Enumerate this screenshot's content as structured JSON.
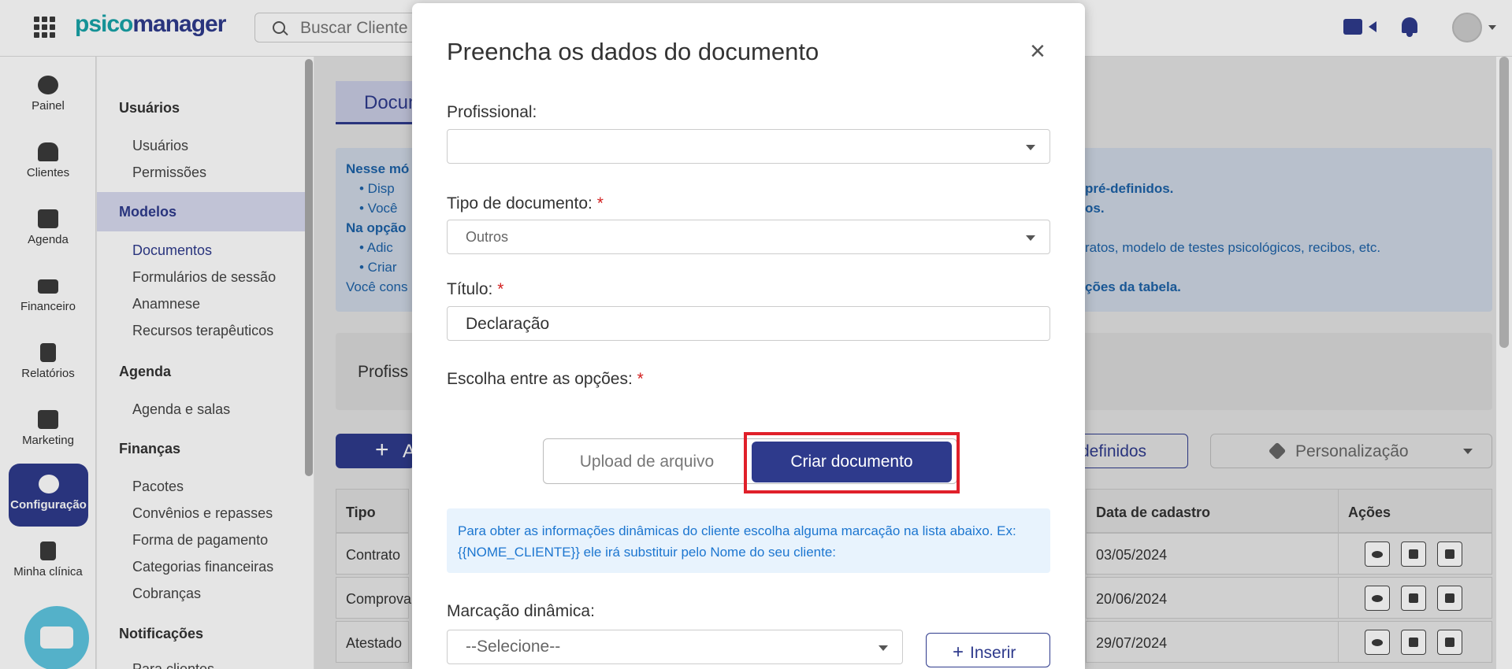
{
  "topbar": {
    "logo_a": "psico",
    "logo_b": "manager",
    "search_placeholder": "Buscar Cliente",
    "icons": [
      "apps-grid-icon",
      "search-icon",
      "video-icon",
      "bell-icon",
      "avatar"
    ]
  },
  "rail": {
    "items": [
      {
        "label": "Painel",
        "icon": "dashboard-icon"
      },
      {
        "label": "Clientes",
        "icon": "users-icon"
      },
      {
        "label": "Agenda",
        "icon": "calendar-icon"
      },
      {
        "label": "Financeiro",
        "icon": "money-icon"
      },
      {
        "label": "Relatórios",
        "icon": "report-icon"
      },
      {
        "label": "Marketing",
        "icon": "megaphone-icon"
      },
      {
        "label": "Configuração",
        "icon": "gear-icon"
      },
      {
        "label": "Minha clínica",
        "icon": "building-icon"
      }
    ]
  },
  "submenu": {
    "sections": [
      {
        "title": "Usuários",
        "items": [
          "Usuários",
          "Permissões"
        ]
      },
      {
        "title": "Modelos",
        "items": [
          "Documentos",
          "Formulários de sessão",
          "Anamnese",
          "Recursos terapêuticos"
        ]
      },
      {
        "title": "Agenda",
        "items": [
          "Agenda e salas"
        ]
      },
      {
        "title": "Finanças",
        "items": [
          "Pacotes",
          "Convênios e repasses",
          "Forma de pagamento",
          "Categorias financeiras",
          "Cobranças"
        ]
      },
      {
        "title": "Notificações",
        "items": [
          "Para clientes"
        ]
      }
    ]
  },
  "background": {
    "tab": "Docum",
    "info_lines": [
      {
        "left": "Nesse mó",
        "right": ""
      },
      {
        "left": "• Disp",
        "right": "pré-definidos."
      },
      {
        "left": "• Você",
        "right": "os."
      },
      {
        "left": "Na opção",
        "right": ""
      },
      {
        "left": "• Adic",
        "right": "ratos, modelo de testes psicológicos, recibos, etc."
      },
      {
        "left": "• Criar",
        "right": ""
      },
      {
        "left": "Você cons",
        "right": "ções da tabela."
      }
    ],
    "prof_label": "Profiss",
    "add_label": "A",
    "predef_label": "definidos",
    "personalizacao_label": "Personalização",
    "table": {
      "headers": [
        "Tipo",
        "Data de cadastro",
        "Ações"
      ],
      "rows": [
        {
          "tipo": "Contrato",
          "data": "03/05/2024"
        },
        {
          "tipo": "Comprovan",
          "data": "20/06/2024"
        },
        {
          "tipo": "Atestado",
          "data": "29/07/2024"
        }
      ]
    }
  },
  "modal": {
    "title": "Preencha os dados do documento",
    "close": "×",
    "profissional_label": "Profissional:",
    "profissional_value": "",
    "tipo_label": "Tipo de documento:",
    "tipo_value": "Outros",
    "titulo_label": "Título:",
    "titulo_value": "Declaração",
    "opcoes_label": "Escolha entre as opções:",
    "required_mark": "*",
    "upload_label": "Upload de arquivo",
    "criar_label": "Criar documento",
    "hint": "Para obter as informações dinâmicas do cliente escolha alguma marcação na lista abaixo. Ex: {{NOME_CLIENTE}} ele irá substituir pelo Nome do seu cliente:",
    "marcacao_label": "Marcação dinâmica:",
    "marcacao_value": "--Selecione--",
    "inserir_plus": "+",
    "inserir_label": "Inserir"
  }
}
